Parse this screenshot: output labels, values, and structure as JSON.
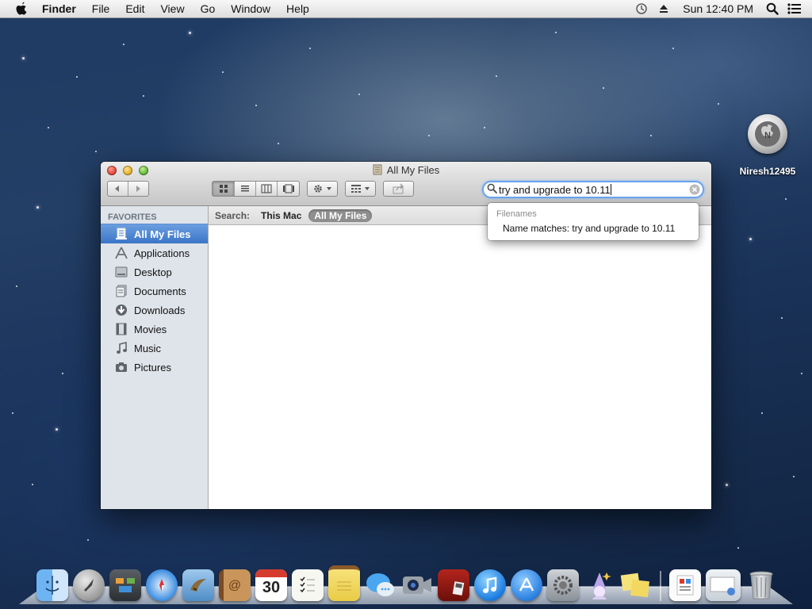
{
  "menubar": {
    "app_name": "Finder",
    "menus": [
      "File",
      "Edit",
      "View",
      "Go",
      "Window",
      "Help"
    ],
    "clock": "Sun 12:40 PM",
    "status_icons": [
      "time-machine-icon",
      "eject-icon",
      "spotlight-icon",
      "notification-center-icon"
    ]
  },
  "window": {
    "title": "All My Files",
    "toolbar": {
      "back_icon": "back-arrow-icon",
      "forward_icon": "forward-arrow-icon",
      "view_modes": [
        "icon-view",
        "list-view",
        "column-view",
        "cover-flow-view"
      ],
      "active_view": "icon-view",
      "action_icon": "gear-icon",
      "arrange_icon": "arrange-icon",
      "share_icon": "share-icon"
    },
    "search": {
      "value": "try and upgrade to 10.11",
      "accent": "#6aa4ef"
    },
    "sidebar": {
      "header": "FAVORITES",
      "items": [
        {
          "label": "All My Files",
          "icon": "all-files-icon",
          "selected": true
        },
        {
          "label": "Applications",
          "icon": "applications-icon"
        },
        {
          "label": "Desktop",
          "icon": "desktop-icon"
        },
        {
          "label": "Documents",
          "icon": "documents-icon"
        },
        {
          "label": "Downloads",
          "icon": "downloads-icon"
        },
        {
          "label": "Movies",
          "icon": "movies-icon"
        },
        {
          "label": "Music",
          "icon": "music-icon"
        },
        {
          "label": "Pictures",
          "icon": "pictures-icon"
        }
      ]
    },
    "scope_bar": {
      "label": "Search:",
      "options": [
        "This Mac",
        "All My Files"
      ],
      "selected": "All My Files"
    }
  },
  "search_popup": {
    "header": "Filenames",
    "result": "Name matches: try and upgrade to 10.11"
  },
  "desktop": {
    "icon_label": "Niresh12495",
    "icon_letter": "N"
  },
  "dock": {
    "items": [
      "finder-icon",
      "launchpad-icon",
      "mission-control-icon",
      "safari-icon",
      "mail-icon",
      "contacts-icon",
      "calendar-icon",
      "reminders-icon",
      "notes-icon",
      "messages-icon",
      "facetime-icon",
      "photo-booth-icon",
      "itunes-icon",
      "app-store-icon",
      "system-preferences-icon",
      "wizard-icon",
      "stickies-icon",
      "preview-icon",
      "mail-attachment-icon",
      "trash-icon"
    ],
    "calendar_day": "30"
  }
}
